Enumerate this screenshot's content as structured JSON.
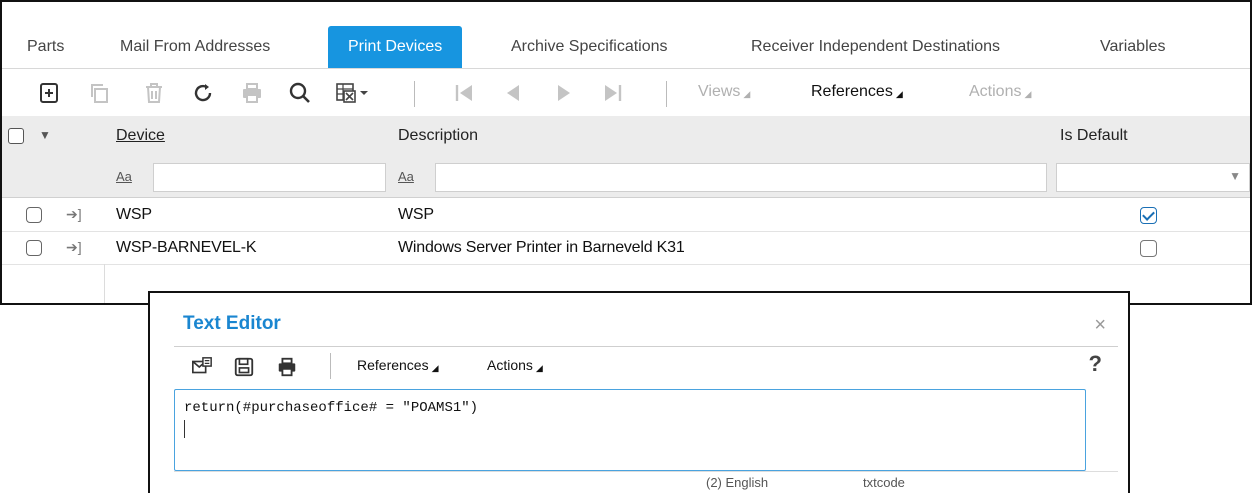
{
  "tabs": [
    {
      "label": "Parts"
    },
    {
      "label": "Mail From Addresses"
    },
    {
      "label": "Print Devices"
    },
    {
      "label": "Archive Specifications"
    },
    {
      "label": "Receiver Independent Destinations"
    },
    {
      "label": "Variables"
    }
  ],
  "active_tab": "Print Devices",
  "toolbar": {
    "views_label": "Views",
    "references_label": "References",
    "actions_label": "Actions"
  },
  "grid": {
    "columns": {
      "device": "Device",
      "description": "Description",
      "is_default": "Is Default"
    },
    "filter_aa": "Aa",
    "rows": [
      {
        "device": "WSP",
        "description": "WSP",
        "is_default": true
      },
      {
        "device": "WSP-BARNEVEL-K",
        "description": "Windows Server Printer in Barneveld K31",
        "is_default": false
      }
    ]
  },
  "dialog": {
    "title": "Text Editor",
    "references_label": "References",
    "actions_label": "Actions",
    "help": "?",
    "close": "×",
    "code": "return(#purchaseoffice# = \"POAMS1\")",
    "status_language": "(2) English",
    "status_mode": "txtcode"
  },
  "colors": {
    "accent": "#1795e0",
    "dialog_title": "#1a86d0"
  }
}
